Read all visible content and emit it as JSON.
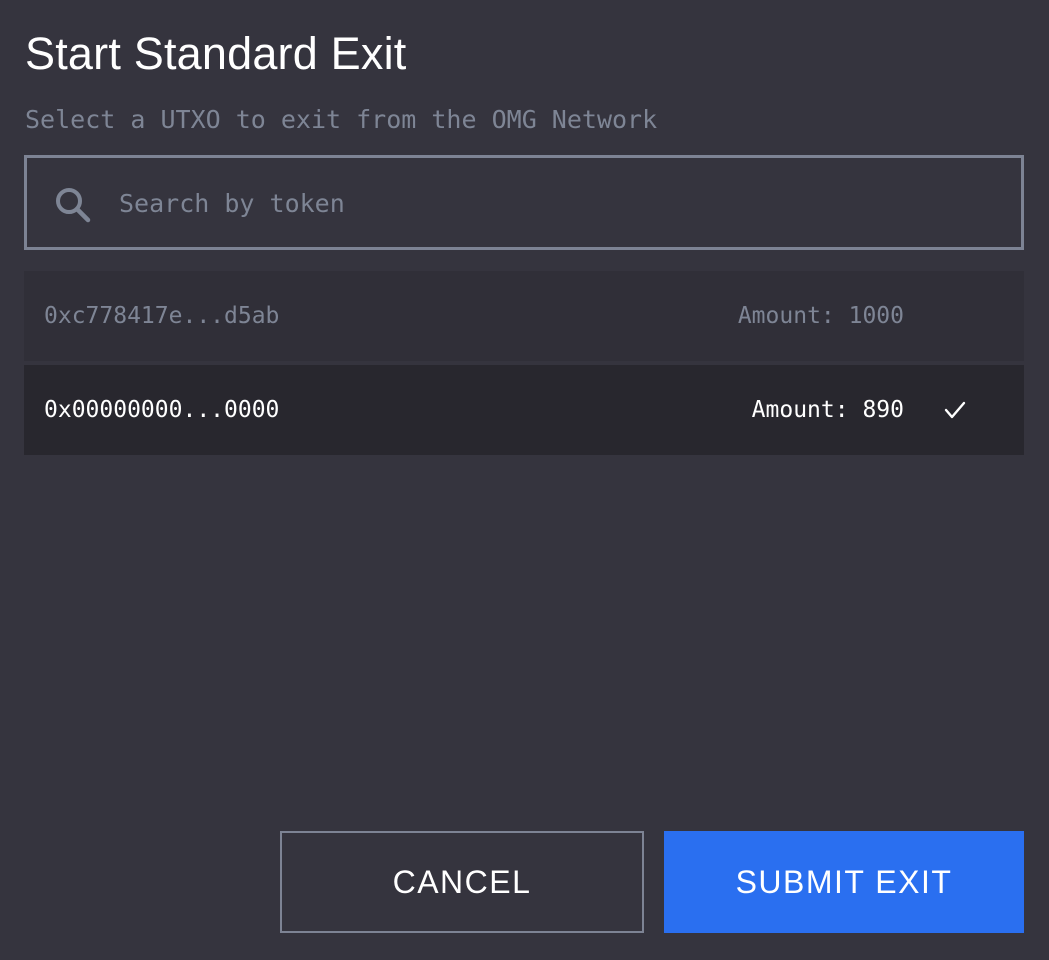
{
  "modal": {
    "title": "Start Standard Exit",
    "subtitle": "Select a UTXO to exit from the OMG Network"
  },
  "search": {
    "placeholder": "Search by token",
    "value": "",
    "icon": "search-icon"
  },
  "utxos": [
    {
      "hash": "0xc778417e...d5ab",
      "amount_label": "Amount: 1000",
      "selected": false
    },
    {
      "hash": "0x00000000...0000",
      "amount_label": "Amount: 890",
      "selected": true,
      "icon": "check-icon"
    }
  ],
  "actions": {
    "cancel_label": "CANCEL",
    "submit_label": "SUBMIT EXIT"
  },
  "colors": {
    "background": "#35343e",
    "muted_text": "#7e8595",
    "border": "#7d8394",
    "row_unselected": "#302f38",
    "row_selected": "#28272e",
    "accent": "#2a6ff0"
  }
}
